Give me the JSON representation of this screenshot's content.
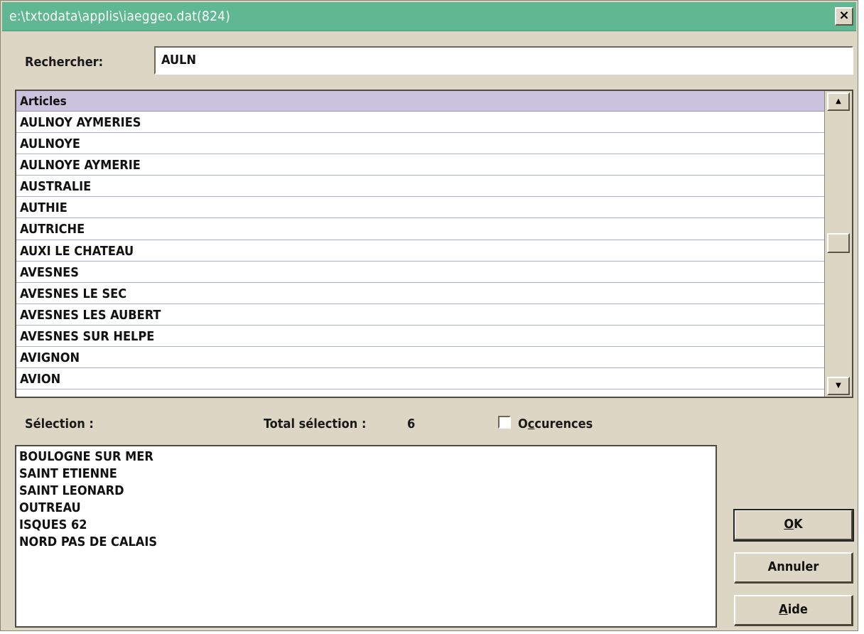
{
  "window": {
    "title": "e:\\txtodata\\applis\\iaeggeo.dat(824)",
    "close_glyph": "×",
    "titlebar_color": "#5fb891",
    "face_color": "#ddd6c4"
  },
  "search": {
    "label": "Rechercher:",
    "value": "AULN"
  },
  "articles": {
    "header": "Articles",
    "rows": [
      "AULNOY AYMERIES",
      "AULNOYE",
      "AULNOYE AYMERIE",
      "AUSTRALIE",
      "AUTHIE",
      "AUTRICHE",
      "AUXI LE CHATEAU",
      "AVESNES",
      "AVESNES LE SEC",
      "AVESNES LES AUBERT",
      "AVESNES SUR HELPE",
      "AVIGNON",
      "AVION"
    ],
    "header_color": "#c8c2dc",
    "scroll_up_icon": "▲",
    "scroll_down_icon": "▼"
  },
  "selection": {
    "label": "Sélection :",
    "total_label": "Total sélection :",
    "total_value": "6",
    "occurences_prefix": "O",
    "occurences_accel": "c",
    "occurences_rest": "curences",
    "items": [
      "BOULOGNE SUR MER",
      "SAINT ETIENNE",
      "SAINT LEONARD",
      "OUTREAU",
      "ISQUES 62",
      "NORD PAS DE CALAIS"
    ]
  },
  "buttons": {
    "ok_accel": "O",
    "ok_rest": "K",
    "annuler": "Annuler",
    "aide_accel": "A",
    "aide_rest": "ide"
  }
}
